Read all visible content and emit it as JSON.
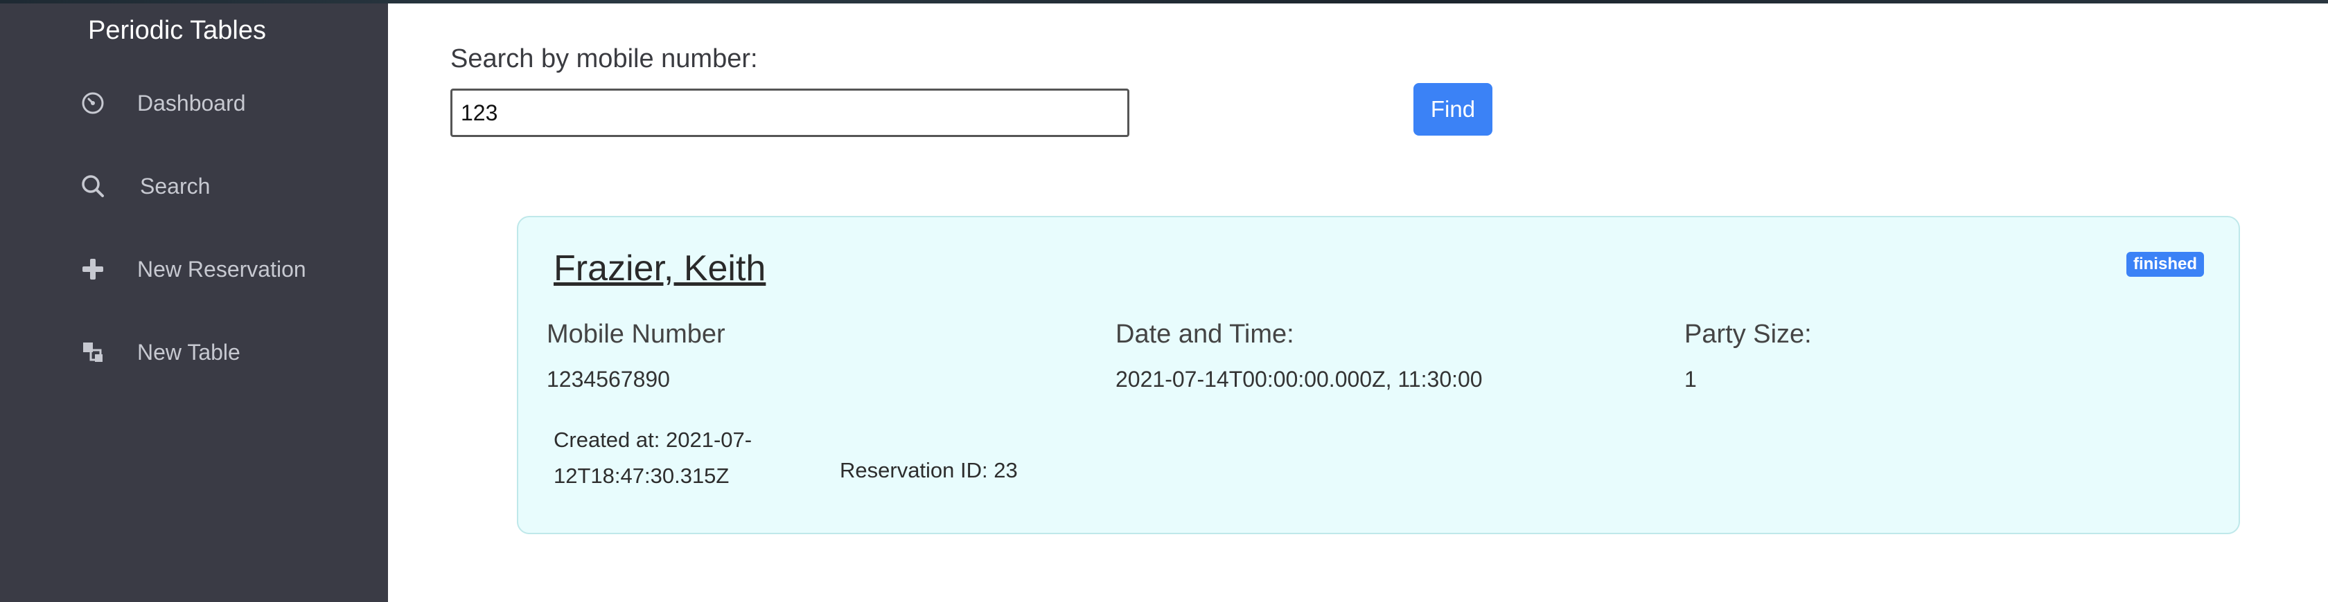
{
  "app": {
    "brand": "Periodic Tables"
  },
  "sidebar": {
    "items": [
      {
        "label": "Dashboard",
        "icon": "dashboard-icon"
      },
      {
        "label": "Search",
        "icon": "search-icon"
      },
      {
        "label": "New Reservation",
        "icon": "plus-icon"
      },
      {
        "label": "New Table",
        "icon": "tables-icon"
      }
    ]
  },
  "search": {
    "label": "Search by mobile number:",
    "value": "123",
    "button": "Find"
  },
  "reservation": {
    "name": "Frazier, Keith",
    "status": "finished",
    "mobile_label": "Mobile Number",
    "mobile_value": "1234567890",
    "datetime_label": "Date and Time:",
    "datetime_value": "2021-07-14T00:00:00.000Z, 11:30:00",
    "party_label": "Party Size:",
    "party_value": "1",
    "created_line1": "Created at: 2021-07-",
    "created_line2": "12T18:47:30.315Z",
    "reservation_id": "Reservation ID: 23"
  },
  "colors": {
    "sidebar_bg": "#3a3b45",
    "accent": "#3b82f6",
    "card_bg": "#e8fcfd"
  }
}
